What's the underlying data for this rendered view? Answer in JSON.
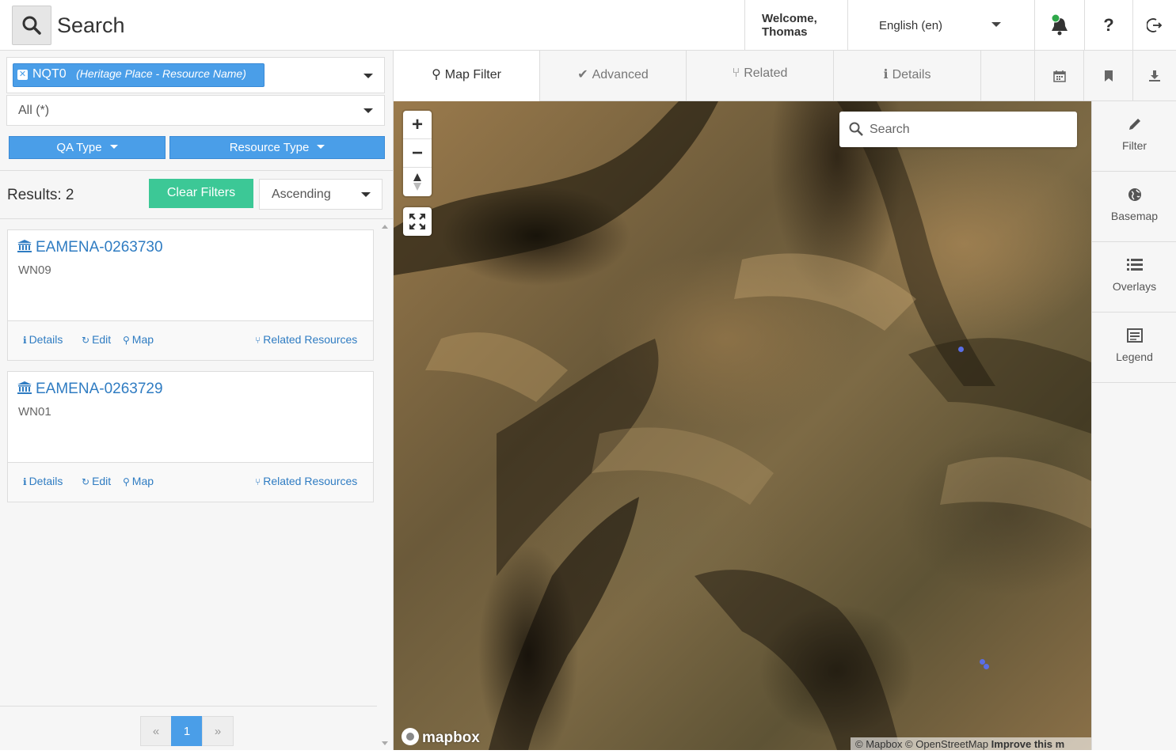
{
  "header": {
    "title": "Search",
    "welcome": "Welcome,",
    "user": "Thomas",
    "language": "English (en)",
    "help": "?"
  },
  "filters": {
    "tag_label": "NQT0",
    "tag_sub": "(Heritage Place - Resource Name)",
    "all_value": "All (*)",
    "qa_type": "QA Type",
    "resource_type": "Resource Type"
  },
  "results": {
    "count_text": "Results: 2",
    "clear_label": "Clear Filters",
    "sort_value": "Ascending",
    "items": [
      {
        "title": "EAMENA-0263730",
        "sub": "WN09"
      },
      {
        "title": "EAMENA-0263729",
        "sub": "WN01"
      }
    ],
    "actions": {
      "details": "Details",
      "edit": "Edit",
      "map": "Map",
      "related": "Related Resources"
    }
  },
  "pager": {
    "prev": "«",
    "current": "1",
    "next": "»"
  },
  "tabs": [
    {
      "label": "Map Filter"
    },
    {
      "label": "Advanced"
    },
    {
      "label": "Related"
    },
    {
      "label": "Details"
    }
  ],
  "map": {
    "search_placeholder": "Search",
    "logo": "mapbox",
    "attribution_1": "© Mapbox © OpenStreetMap",
    "attribution_2": "Improve this m"
  },
  "rightbar": [
    {
      "label": "Filter",
      "icon": "pencil-icon"
    },
    {
      "label": "Basemap",
      "icon": "globe-icon"
    },
    {
      "label": "Overlays",
      "icon": "list-icon"
    },
    {
      "label": "Legend",
      "icon": "legend-icon"
    }
  ],
  "colors": {
    "primary": "#4a9ee8",
    "success": "#3cc896",
    "link": "#2f7cc2"
  }
}
